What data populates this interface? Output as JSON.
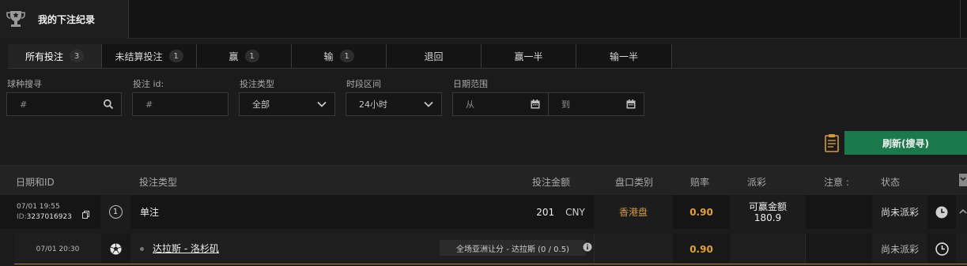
{
  "header": {
    "title": "我的下注纪录",
    "icon": "trophy-icon"
  },
  "tabs": [
    {
      "label": "所有投注",
      "count": "3",
      "active": true
    },
    {
      "label": "未结算投注",
      "count": "1"
    },
    {
      "label": "赢",
      "count": "1"
    },
    {
      "label": "输",
      "count": "1"
    },
    {
      "label": "退回"
    },
    {
      "label": "赢一半"
    },
    {
      "label": "输一半"
    }
  ],
  "filters": {
    "sport_label": "球种搜寻",
    "sport_placeholder": "#",
    "betid_label": "投注 id:",
    "betid_placeholder": "#",
    "bettype_label": "投注类型",
    "bettype_value": "全部",
    "period_label": "时段区间",
    "period_value": "24小时",
    "daterange_label": "日期范围",
    "from_placeholder": "从",
    "to_placeholder": "到"
  },
  "refresh_label": "刷新(搜寻)",
  "table": {
    "headers": {
      "date_id": "日期和ID",
      "bet_type": "投注类型",
      "amount": "投注金额",
      "market": "盘口类别",
      "odds": "赔率",
      "payout": "派彩",
      "note": "注意 :",
      "status": "状态"
    },
    "bet": {
      "date": "07/01 19:55",
      "id_prefix": "ID:",
      "id": "3237016923",
      "count": "1",
      "type": "单注",
      "amount": "201",
      "currency": "CNY",
      "market": "香港盘",
      "odds": "0.90",
      "payout_label": "可赢金额",
      "payout_value": "180.9",
      "status": "尚未派彩"
    },
    "selection": {
      "date": "07/01 20:30",
      "match": "达拉斯 - 洛杉矶",
      "pick": "全场亚洲让分 - 达拉斯 (0 / 0.5)",
      "odds": "0.90",
      "status": "尚未派彩"
    }
  },
  "colors": {
    "accent_green": "#1b7a4b",
    "odds_gold": "#e2a12f",
    "market_gold": "#d29b3a"
  }
}
